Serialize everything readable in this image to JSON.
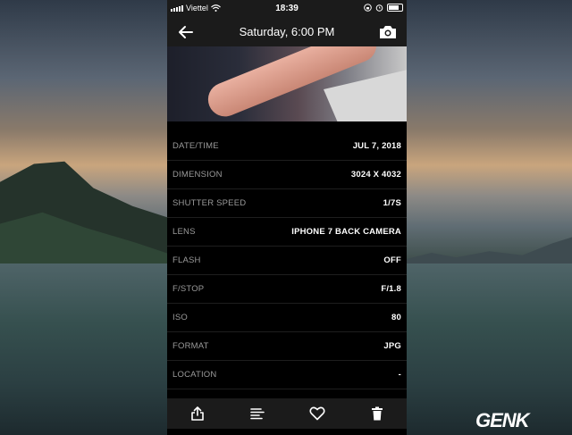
{
  "status_bar": {
    "carrier": "Viettel",
    "time": "18:39",
    "icons": [
      "signal-icon",
      "wifi-icon",
      "lock-rotation-icon",
      "alarm-icon",
      "battery-icon"
    ]
  },
  "nav": {
    "title": "Saturday, 6:00 PM",
    "back_icon": "arrow-left-icon",
    "camera_icon": "camera-icon"
  },
  "details": [
    {
      "label": "DATE/TIME",
      "value": "JUL 7, 2018"
    },
    {
      "label": "DIMENSION",
      "value": "3024 X 4032"
    },
    {
      "label": "SHUTTER SPEED",
      "value": "1/7S"
    },
    {
      "label": "LENS",
      "value": "IPHONE 7 BACK CAMERA"
    },
    {
      "label": "FLASH",
      "value": "OFF"
    },
    {
      "label": "F/STOP",
      "value": "F/1.8"
    },
    {
      "label": "ISO",
      "value": "80"
    },
    {
      "label": "FORMAT",
      "value": "JPG"
    },
    {
      "label": "LOCATION",
      "value": "-"
    }
  ],
  "toolbar": {
    "icons": [
      "share-icon",
      "details-icon",
      "heart-icon",
      "trash-icon"
    ]
  },
  "watermark": {
    "brand": "GENK"
  },
  "colors": {
    "app_bg": "#000000",
    "bar_bg": "#1b1b1b",
    "label": "#9a9a9a",
    "value": "#ffffff",
    "logo_accent": "#e53a2b"
  }
}
